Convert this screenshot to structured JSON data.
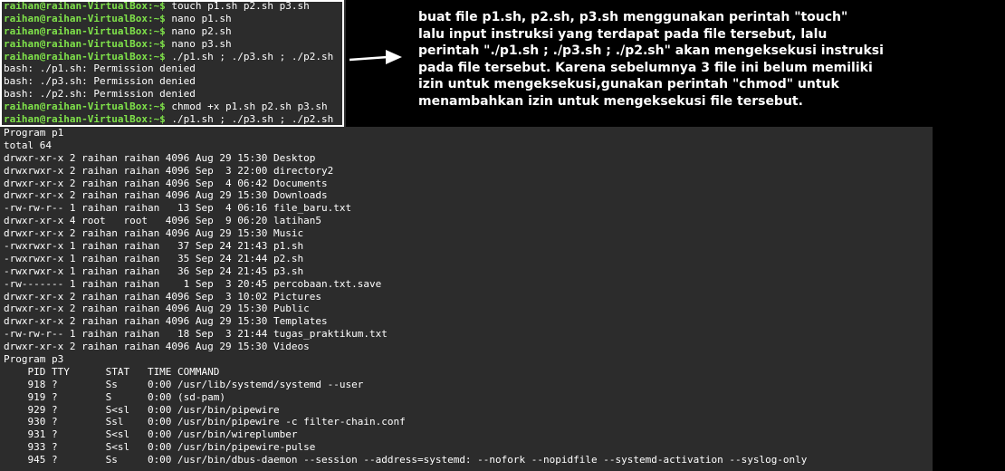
{
  "terminal": {
    "prompt": "raihan@raihan-VirtualBox:~$",
    "top_lines": [
      {
        "type": "cmd",
        "text": " touch p1.sh p2.sh p3.sh"
      },
      {
        "type": "cmd",
        "text": " nano p1.sh"
      },
      {
        "type": "cmd",
        "text": " nano p2.sh"
      },
      {
        "type": "cmd",
        "text": " nano p3.sh"
      },
      {
        "type": "cmd",
        "text": " ./p1.sh ; ./p3.sh ; ./p2.sh"
      },
      {
        "type": "out",
        "text": "bash: ./p1.sh: Permission denied"
      },
      {
        "type": "out",
        "text": "bash: ./p3.sh: Permission denied"
      },
      {
        "type": "out",
        "text": "bash: ./p2.sh: Permission denied"
      },
      {
        "type": "cmd",
        "text": " chmod +x p1.sh p2.sh p3.sh"
      },
      {
        "type": "cmd",
        "text": " ./p1.sh ; ./p3.sh ; ./p2.sh"
      }
    ],
    "output_lines": [
      "Program p1",
      "total 64",
      "drwxr-xr-x 2 raihan raihan 4096 Aug 29 15:30 Desktop",
      "drwxrwxr-x 2 raihan raihan 4096 Sep  3 22:00 directory2",
      "drwxr-xr-x 2 raihan raihan 4096 Sep  4 06:42 Documents",
      "drwxr-xr-x 2 raihan raihan 4096 Aug 29 15:30 Downloads",
      "-rw-rw-r-- 1 raihan raihan   13 Sep  4 06:16 file_baru.txt",
      "drwxr-xr-x 4 root   root   4096 Sep  9 06:20 latihan5",
      "drwxr-xr-x 2 raihan raihan 4096 Aug 29 15:30 Music",
      "-rwxrwxr-x 1 raihan raihan   37 Sep 24 21:43 p1.sh",
      "-rwxrwxr-x 1 raihan raihan   35 Sep 24 21:44 p2.sh",
      "-rwxrwxr-x 1 raihan raihan   36 Sep 24 21:45 p3.sh",
      "-rw------- 1 raihan raihan    1 Sep  3 20:45 percobaan.txt.save",
      "drwxr-xr-x 2 raihan raihan 4096 Sep  3 10:02 Pictures",
      "drwxr-xr-x 2 raihan raihan 4096 Aug 29 15:30 Public",
      "drwxr-xr-x 2 raihan raihan 4096 Aug 29 15:30 Templates",
      "-rw-rw-r-- 1 raihan raihan   18 Sep  3 21:44 tugas_praktikum.txt",
      "drwxr-xr-x 2 raihan raihan 4096 Aug 29 15:30 Videos",
      "Program p3",
      "    PID TTY      STAT   TIME COMMAND",
      "    918 ?        Ss     0:00 /usr/lib/systemd/systemd --user",
      "    919 ?        S      0:00 (sd-pam)",
      "    929 ?        S<sl   0:00 /usr/bin/pipewire",
      "    930 ?        Ssl    0:00 /usr/bin/pipewire -c filter-chain.conf",
      "    931 ?        S<sl   0:00 /usr/bin/wireplumber",
      "    933 ?        S<sl   0:00 /usr/bin/pipewire-pulse",
      "    945 ?        Ss     0:00 /usr/bin/dbus-daemon --session --address=systemd: --nofork --nopidfile --systemd-activation --syslog-only"
    ]
  },
  "annotation": {
    "lines": [
      "buat file p1.sh, p2.sh, p3.sh menggunakan perintah \"touch\"",
      "lalu input instruksi yang terdapat pada file tersebut, lalu",
      "perintah \"./p1.sh ; ./p3.sh ; ./p2.sh\" akan mengeksekusi instruksi",
      "pada file tersebut. Karena sebelumnya 3 file ini belum memiliki",
      "izin untuk mengeksekusi,gunakan perintah \"chmod\" untuk",
      "menambahkan izin untuk mengeksekusi file tersebut."
    ]
  },
  "colors": {
    "terminal_bg": "#2c2c2c",
    "prompt": "#7fe24a",
    "text": "#ffffff",
    "annotation_bg": "#000000"
  }
}
